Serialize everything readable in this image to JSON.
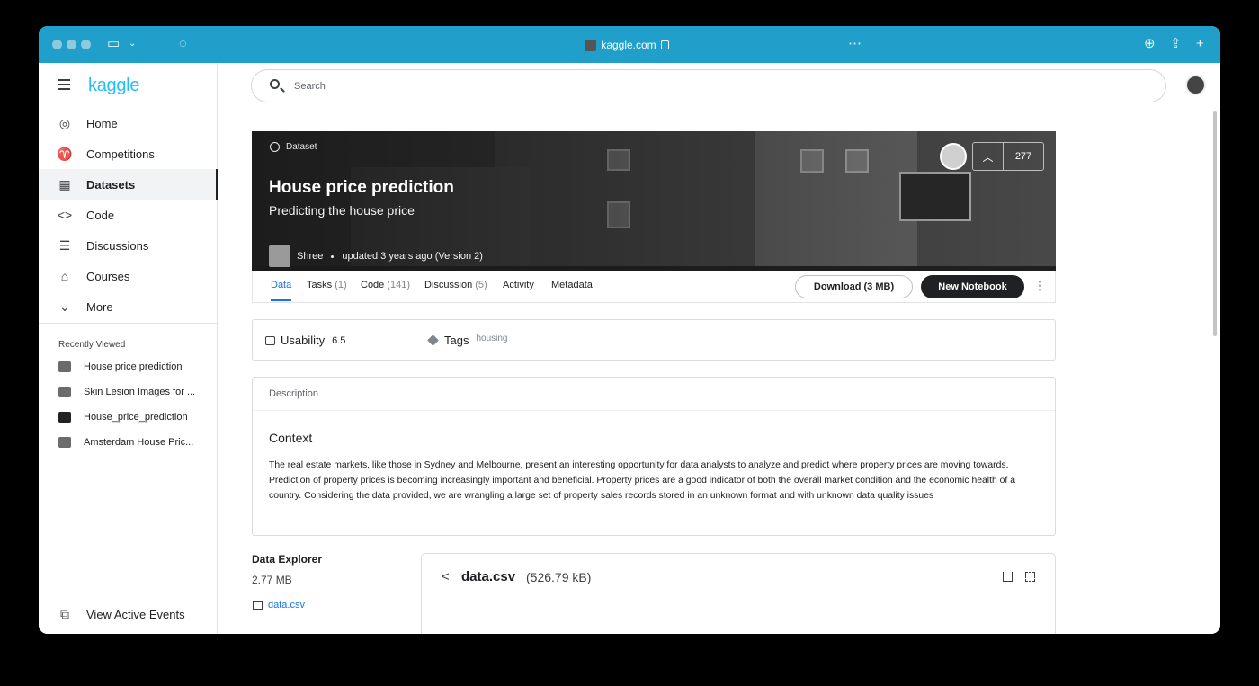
{
  "browser": {
    "url": "kaggle.com"
  },
  "sidebar": {
    "logo": "kaggle",
    "items": [
      {
        "label": "Home",
        "icon": "compass-icon"
      },
      {
        "label": "Competitions",
        "icon": "trophy-icon"
      },
      {
        "label": "Datasets",
        "icon": "table-icon",
        "active": true
      },
      {
        "label": "Code",
        "icon": "code-icon"
      },
      {
        "label": "Discussions",
        "icon": "comment-icon"
      },
      {
        "label": "Courses",
        "icon": "school-icon"
      },
      {
        "label": "More",
        "icon": "chevron-down-icon"
      }
    ],
    "recently_viewed_title": "Recently Viewed",
    "recently_viewed": [
      "House price prediction",
      "Skin Lesion Images for ...",
      "House_price_prediction",
      "Amsterdam House Pric..."
    ],
    "footer_label": "View Active Events"
  },
  "search": {
    "placeholder": "Search"
  },
  "dataset": {
    "tag": "Dataset",
    "title": "House price prediction",
    "subtitle": "Predicting the house price",
    "author": "Shree",
    "updated": "updated 3 years ago (Version 2)",
    "votes": "277"
  },
  "tabs": [
    {
      "label": "Data",
      "count": ""
    },
    {
      "label": "Tasks",
      "count": "(1)"
    },
    {
      "label": "Code",
      "count": "(141)"
    },
    {
      "label": "Discussion",
      "count": "(5)"
    },
    {
      "label": "Activity",
      "count": ""
    },
    {
      "label": "Metadata",
      "count": ""
    }
  ],
  "actions": {
    "download": "Download (3 MB)",
    "new_notebook": "New Notebook"
  },
  "usability": {
    "label": "Usability",
    "value": "6.5",
    "tags_label": "Tags",
    "tags_value": "housing"
  },
  "description": {
    "header": "Description",
    "heading": "Context",
    "body": "The real estate markets, like those in Sydney and Melbourne, present an interesting opportunity for data analysts to analyze and predict where property prices are moving towards. Prediction of property prices is becoming increasingly important and beneficial. Property prices are a good indicator of both the overall market condition and the economic health of a country. Considering the data provided, we are wrangling a large set of property sales records stored in an unknown format and with unknown data quality issues"
  },
  "data_explorer": {
    "title": "Data Explorer",
    "size": "2.77 MB",
    "file": "data.csv"
  },
  "file_panel": {
    "name": "data.csv",
    "size": "(526.79 kB)"
  },
  "colors": {
    "chrome": "#1f9fc9",
    "kaggle_blue": "#20beff",
    "link": "#1a73e8",
    "dark_button": "#202124"
  }
}
